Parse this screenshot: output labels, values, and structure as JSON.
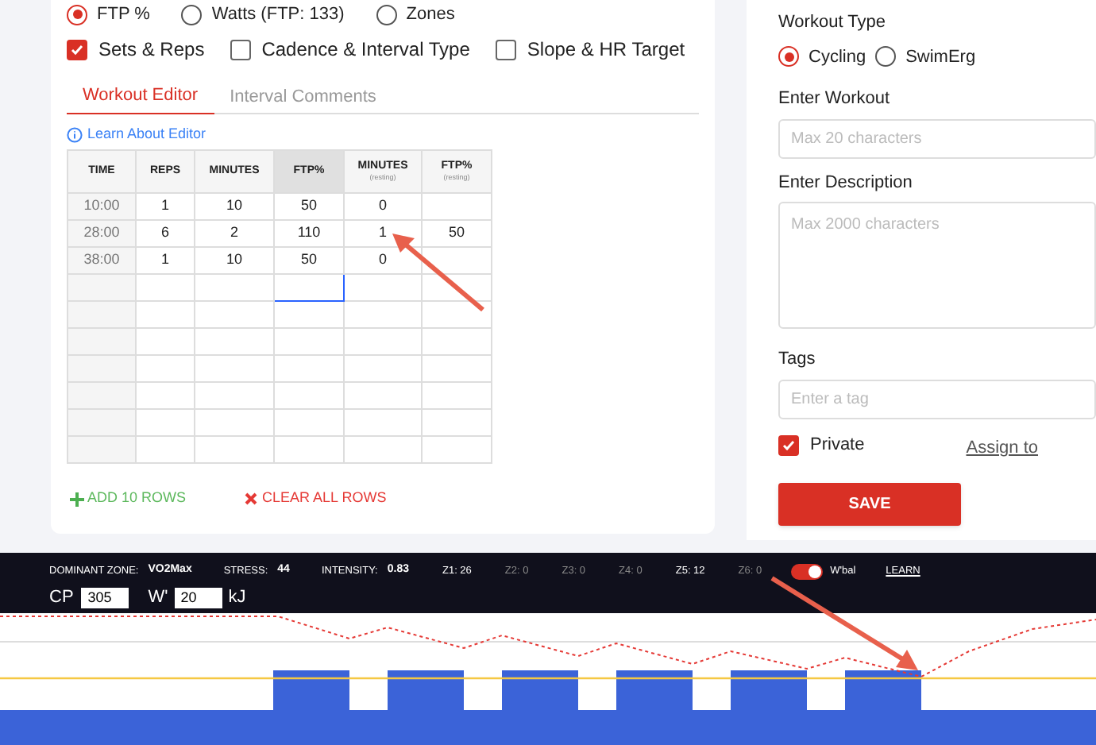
{
  "target_options": [
    {
      "label": "FTP %",
      "selected": true
    },
    {
      "label": "Watts (FTP: 133)",
      "selected": false
    },
    {
      "label": "Zones",
      "selected": false
    }
  ],
  "columns_options": [
    {
      "label": "Sets & Reps",
      "checked": true
    },
    {
      "label": "Cadence & Interval Type",
      "checked": false
    },
    {
      "label": "Slope & HR Target",
      "checked": false
    }
  ],
  "tabs": [
    {
      "label": "Workout Editor",
      "selected": true
    },
    {
      "label": "Interval Comments",
      "selected": false
    }
  ],
  "learn_link": "Learn About Editor",
  "table": {
    "columns": [
      {
        "label": "TIME",
        "selected": false
      },
      {
        "label": "REPS",
        "selected": false
      },
      {
        "label": "MINUTES",
        "selected": false
      },
      {
        "label": "FTP%",
        "selected": true
      },
      {
        "label": "MINUTES",
        "sublabel": "(resting)",
        "selected": false
      },
      {
        "label": "FTP%",
        "sublabel": "(resting)",
        "selected": false
      }
    ],
    "rows": [
      {
        "cells": [
          {
            "text": "10:00",
            "selected": false
          },
          {
            "text": "1",
            "selected": false
          },
          {
            "text": "10",
            "selected": false
          },
          {
            "text": "50",
            "selected": false
          },
          {
            "text": "0",
            "selected": false
          },
          {
            "selected": false
          }
        ]
      },
      {
        "cells": [
          {
            "text": "28:00",
            "selected": false
          },
          {
            "text": "6",
            "selected": false
          },
          {
            "text": "2",
            "selected": false
          },
          {
            "text": "110",
            "selected": false
          },
          {
            "text": "1",
            "selected": false
          },
          {
            "text": "50",
            "selected": false
          }
        ]
      },
      {
        "cells": [
          {
            "text": "38:00",
            "selected": false
          },
          {
            "text": "1",
            "selected": false
          },
          {
            "text": "10",
            "selected": false
          },
          {
            "text": "50",
            "selected": false
          },
          {
            "text": "0",
            "selected": false
          },
          {
            "selected": false
          }
        ]
      },
      {
        "cells": [
          {
            "selected": false
          },
          {
            "selected": false
          },
          {
            "selected": false
          },
          {
            "selected": true
          },
          {
            "selected": false
          },
          {
            "selected": false
          }
        ]
      },
      {
        "cells": [
          {
            "selected": false
          },
          {
            "selected": false
          },
          {
            "selected": false
          },
          {
            "selected": false
          },
          {
            "selected": false
          },
          {
            "selected": false
          }
        ]
      },
      {
        "cells": [
          {
            "selected": false
          },
          {
            "selected": false
          },
          {
            "selected": false
          },
          {
            "selected": false
          },
          {
            "selected": false
          },
          {
            "selected": false
          }
        ]
      },
      {
        "cells": [
          {
            "selected": false
          },
          {
            "selected": false
          },
          {
            "selected": false
          },
          {
            "selected": false
          },
          {
            "selected": false
          },
          {
            "selected": false
          }
        ]
      },
      {
        "cells": [
          {
            "selected": false
          },
          {
            "selected": false
          },
          {
            "selected": false
          },
          {
            "selected": false
          },
          {
            "selected": false
          },
          {
            "selected": false
          }
        ]
      },
      {
        "cells": [
          {
            "selected": false
          },
          {
            "selected": false
          },
          {
            "selected": false
          },
          {
            "selected": false
          },
          {
            "selected": false
          },
          {
            "selected": false
          }
        ]
      },
      {
        "cells": [
          {
            "selected": false
          },
          {
            "selected": false
          },
          {
            "selected": false
          },
          {
            "selected": false
          },
          {
            "selected": false
          },
          {
            "selected": false
          }
        ]
      }
    ]
  },
  "add_rows": "ADD 10 ROWS",
  "clear_rows": "CLEAR ALL ROWS",
  "workout_type": {
    "label": "Workout Type",
    "options": [
      {
        "label": "Cycling",
        "selected": true
      },
      {
        "label": "SwimErg",
        "selected": false
      }
    ]
  },
  "workout_name": {
    "label": "Enter Workout",
    "placeholder": "Max 20 characters"
  },
  "description": {
    "label": "Enter Description",
    "placeholder": "Max 2000 characters"
  },
  "tags": {
    "label": "Tags",
    "placeholder": "Enter a tag"
  },
  "private": {
    "label": "Private",
    "checked": true
  },
  "assign_link": "Assign to",
  "save": "SAVE",
  "stats": [
    {
      "label": "DOMINANT ZONE:",
      "value": "VO2Max"
    },
    {
      "label": "STRESS:",
      "value": "44"
    },
    {
      "label": "INTENSITY:",
      "value": "0.83"
    }
  ],
  "zones": [
    {
      "text": "Z1: 26",
      "dim": false
    },
    {
      "text": "Z2: 0",
      "dim": true
    },
    {
      "text": "Z3: 0",
      "dim": true
    },
    {
      "text": "Z4: 0",
      "dim": true
    },
    {
      "text": "Z5: 12",
      "dim": false
    },
    {
      "text": "Z6: 0",
      "dim": true
    }
  ],
  "wbal": {
    "label": "W'bal",
    "on": true
  },
  "learn": "LEARN",
  "cp": {
    "label": "CP",
    "value": "305"
  },
  "w_prime": {
    "label": "W'",
    "value": "20",
    "unit": "kJ"
  }
}
